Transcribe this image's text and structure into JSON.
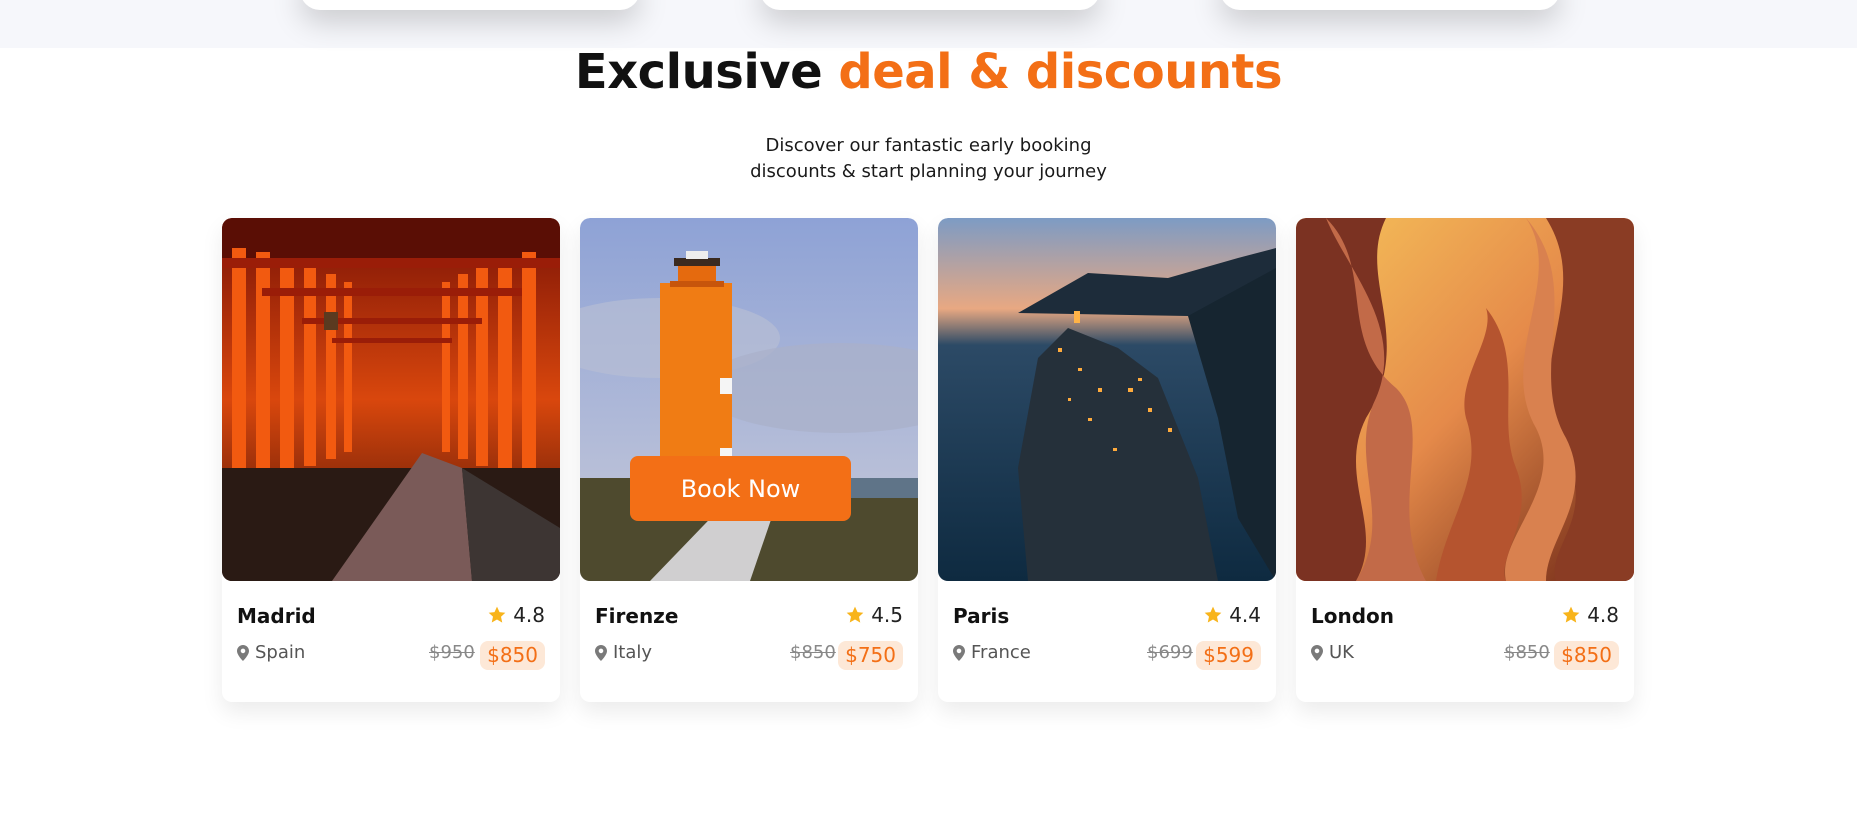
{
  "section": {
    "title_main": "Exclusive",
    "title_accent": "deal & discounts",
    "subtitle_line1": "Discover our fantastic early booking",
    "subtitle_line2": "discounts & start planning your journey"
  },
  "cards": [
    {
      "title": "Madrid",
      "rating": "4.8",
      "location": "Spain",
      "old_price": "$950",
      "new_price": "$850",
      "image": "red torii gate tunnel"
    },
    {
      "title": "Firenze",
      "rating": "4.5",
      "location": "Italy",
      "old_price": "$850",
      "new_price": "$750",
      "image": "orange lighthouse tower",
      "button_label": "Book Now"
    },
    {
      "title": "Paris",
      "rating": "4.4",
      "location": "France",
      "old_price": "$699",
      "new_price": "$599",
      "image": "cliffside village at dusk"
    },
    {
      "title": "London",
      "rating": "4.8",
      "location": "UK",
      "old_price": "$850",
      "new_price": "$850",
      "image": "sandstone slot canyon"
    }
  ],
  "colors": {
    "accent": "#f36f16",
    "star": "#f8b41b",
    "price_badge_bg": "#fde8d7"
  },
  "icons": {
    "rating": "star-icon",
    "location": "map-pin-icon"
  }
}
